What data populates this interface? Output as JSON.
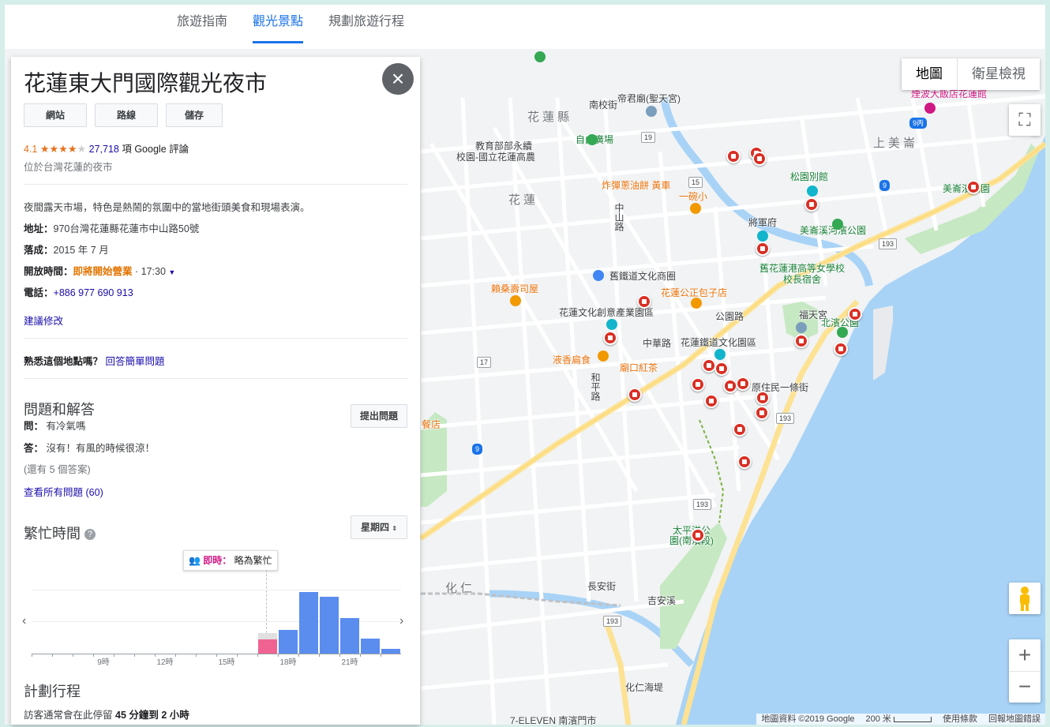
{
  "tabs": [
    {
      "label": "旅遊指南",
      "active": false
    },
    {
      "label": "觀光景點",
      "active": true
    },
    {
      "label": "規劃旅遊行程",
      "active": false
    }
  ],
  "panel": {
    "title": "花蓮東大門國際觀光夜市",
    "close_icon": "close-icon",
    "buttons": [
      "網站",
      "路線",
      "儲存"
    ],
    "rating": "4.1",
    "stars": 4,
    "review_count": "27,718",
    "review_text": "項 Google 評論",
    "subtitle": "位於台灣花蓮的夜市",
    "description": "夜間露天市場，特色是熱鬧的氛圍中的當地街頭美食和現場表演。",
    "address_key": "地址：",
    "address": "970台灣花蓮縣花蓮市中山路50號",
    "completed_key": "落成：",
    "completed": "2015 年 7 月",
    "hours_key": "開放時間：",
    "hours_status": "即將開始營業",
    "hours_time": "· 17:30",
    "phone_key": "電話：",
    "phone": "+886 977 690 913",
    "suggest_edit": "建議修改",
    "know_place": "熟悉這個地點嗎？",
    "answer_quick": "回答簡單問題",
    "qa_title": "問題和解答",
    "ask_button": "提出問題",
    "q_key": "問：",
    "question": "有冷氣嗎",
    "a_key": "答：",
    "answer": "沒有！有風的時候很涼！",
    "more_answers": "(還有 5 個答案)",
    "see_all": "查看所有問題",
    "see_all_count": "(60)",
    "popular_title": "繁忙時間",
    "day_select": "星期四",
    "live_label": "即時：",
    "live_value": "略為繁忙",
    "plan_title": "計劃行程",
    "plan_text_pre": "訪客通常會在此停留",
    "plan_text_bold": "45 分鐘到 2 小時"
  },
  "chart_data": {
    "type": "bar",
    "title": "繁忙時間",
    "x_tick_labels": [
      "9時",
      "12時",
      "15時",
      "18時",
      "21時"
    ],
    "categories": [
      "6時",
      "7時",
      "8時",
      "9時",
      "10時",
      "11時",
      "12時",
      "13時",
      "14時",
      "15時",
      "16時",
      "17時",
      "18時",
      "19時",
      "20時",
      "21時",
      "22時",
      "23時"
    ],
    "values": [
      0,
      0,
      0,
      0,
      0,
      0,
      0,
      0,
      0,
      0,
      0,
      0,
      37,
      98,
      90,
      56,
      24,
      7
    ],
    "live": {
      "category": "17時",
      "value": 22,
      "usual": 32
    },
    "colors": {
      "bars": "#5b8def",
      "live": "#f06292",
      "usual": "#e0e0e0"
    }
  },
  "map": {
    "maptype_on": "地圖",
    "maptype_off": "衛星檢視",
    "attribution": [
      "地圖資料 ©2019 Google",
      "200 米",
      "使用條款",
      "回報地圖錯誤"
    ],
    "labels": [
      "花蓮縣",
      "花蓮",
      "化仁",
      "上美崙",
      "自由廣場",
      "教育部部永續",
      "校園-國立花蓮高農",
      "帝君廟(聖天宮)",
      "南校街",
      "炸彈蔥油餅 黃車",
      "一碗小",
      "舊鐵道文化商圈",
      "花蓮公正包子店",
      "賴桑壽司屋",
      "花蓮文化創意產業園區",
      "花蓮鐵道文化園區",
      "液香扁食",
      "廟口紅茶",
      "將軍府",
      "松園別館",
      "美崙溪河濱公園",
      "舊花蓮港高等女學校校長宿舍",
      "福天宮",
      "北濱公園",
      "原住民一條街",
      "太平洋公園(南濱段)",
      "美崙濱公園",
      "煙波大飯店花蓮館",
      "長安街",
      "中華路",
      "中山路",
      "和平路",
      "公園路",
      "化仁海堤",
      "7-ELEVEN 南濱門市",
      "餐店",
      "吉安溪"
    ],
    "routes": [
      "193",
      "193",
      "193",
      "193",
      "9",
      "9",
      "9丙",
      "17",
      "19",
      "15"
    ]
  }
}
